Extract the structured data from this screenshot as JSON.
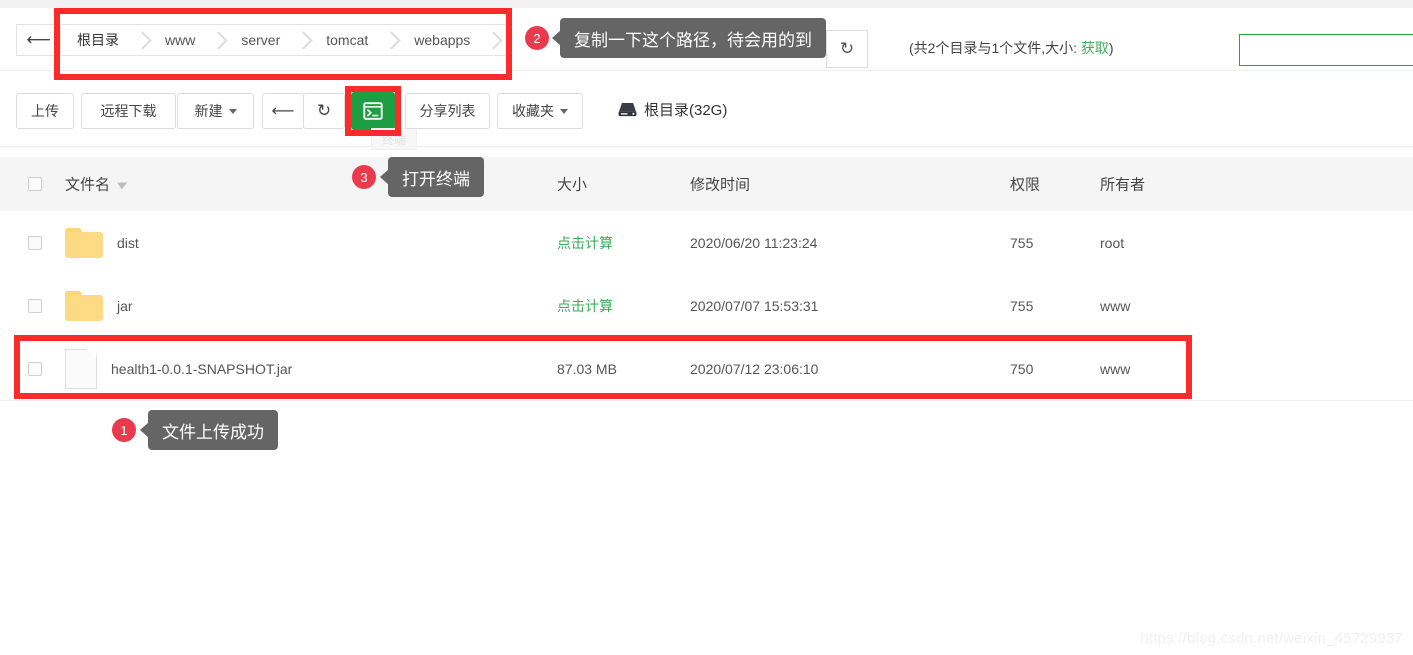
{
  "breadcrumb": {
    "back_icon": "arrow-left-icon",
    "items": [
      "根目录",
      "www",
      "server",
      "tomcat",
      "webapps"
    ]
  },
  "header": {
    "refresh_icon": "refresh-icon",
    "dir_summary_prefix": "(共2个目录与1个文件,大小: ",
    "dir_summary_link": "获取",
    "dir_summary_suffix": ")",
    "search_value": ""
  },
  "toolbar": {
    "upload_label": "上传",
    "remote_download_label": "远程下载",
    "new_label": "新建",
    "back_icon": "arrow-left-icon",
    "refresh_icon": "refresh-icon",
    "terminal_icon": "terminal-icon",
    "terminal_ghost_tooltip": "终端",
    "share_list_label": "分享列表",
    "favorites_label": "收藏夹",
    "disk_icon": "hard-drive-icon",
    "disk_label": "根目录(32G)"
  },
  "table": {
    "columns": {
      "select_all": "select-all-checkbox",
      "filename": "文件名",
      "sort_icon": "sort-desc-icon",
      "size": "大小",
      "mtime": "修改时间",
      "permission": "权限",
      "owner": "所有者"
    },
    "rows": [
      {
        "kind": "folder",
        "icon": "folder-icon",
        "name": "dist",
        "size": "点击计算",
        "size_is_link": true,
        "mtime": "2020/06/20 11:23:24",
        "permission": "755",
        "owner": "root",
        "highlighted": false
      },
      {
        "kind": "folder",
        "icon": "folder-icon",
        "name": "jar",
        "size": "点击计算",
        "size_is_link": true,
        "mtime": "2020/07/07 15:53:31",
        "permission": "755",
        "owner": "www",
        "highlighted": false
      },
      {
        "kind": "file",
        "icon": "file-icon",
        "name": "health1-0.0.1-SNAPSHOT.jar",
        "size": "87.03 MB",
        "size_is_link": false,
        "mtime": "2020/07/12 23:06:10",
        "permission": "750",
        "owner": "www",
        "highlighted": true
      }
    ]
  },
  "annotations": [
    {
      "number": "1",
      "text": "文件上传成功"
    },
    {
      "number": "2",
      "text": "复制一下这个路径，待会用的到"
    },
    {
      "number": "3",
      "text": "打开终端"
    }
  ],
  "watermark": "https://blog.csdn.net/weixin_45729937",
  "colors": {
    "accent_green": "#1e9e43",
    "link_green": "#3aab5a",
    "annotation_red": "#fb2b2b",
    "badge_red": "#ea3a4e",
    "tooltip_gray": "#656565",
    "folder_yellow": "#fddb85"
  }
}
